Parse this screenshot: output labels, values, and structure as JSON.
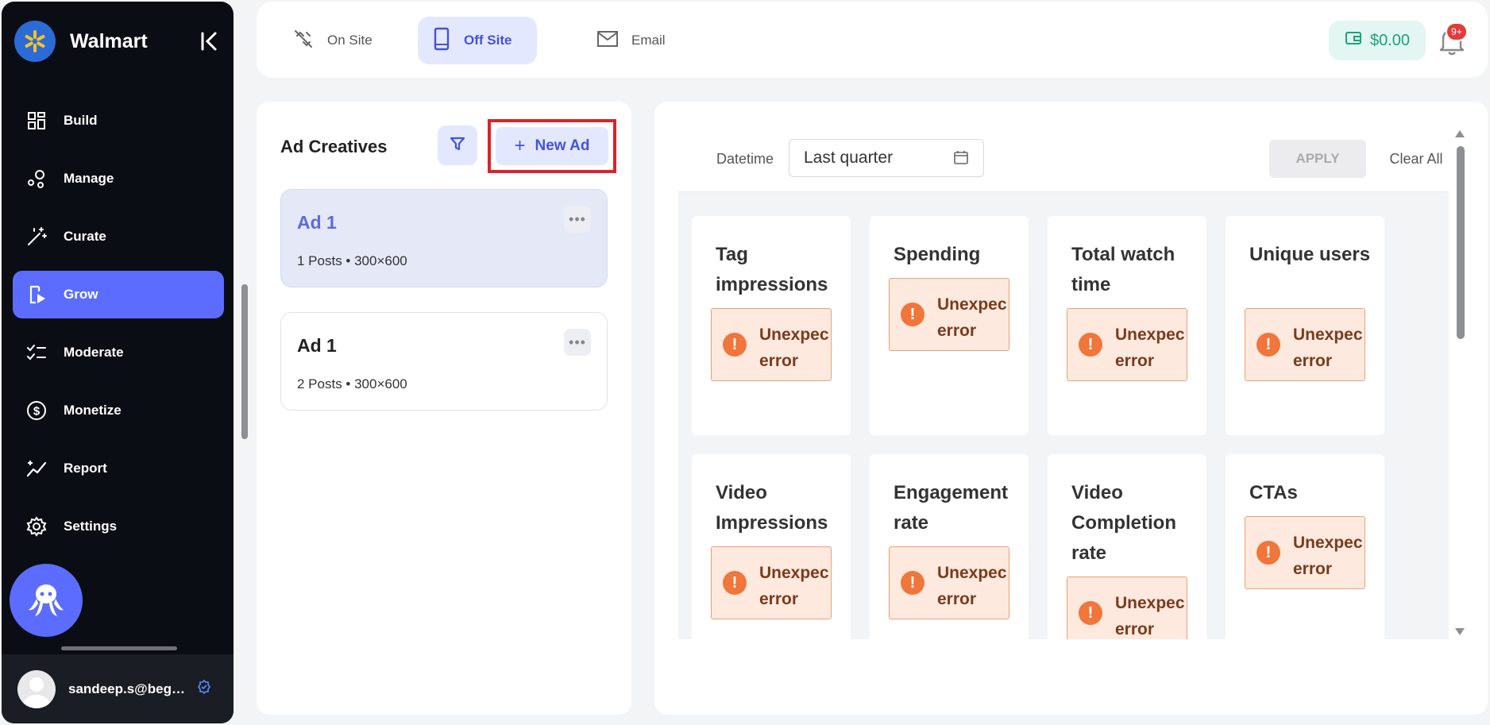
{
  "brand": {
    "name": "Walmart"
  },
  "sidebar": {
    "items": [
      {
        "label": "Build",
        "icon": "grid-icon"
      },
      {
        "label": "Manage",
        "icon": "manage-icon"
      },
      {
        "label": "Curate",
        "icon": "magic-wand-icon"
      },
      {
        "label": "Grow",
        "icon": "grow-icon",
        "active": true
      },
      {
        "label": "Moderate",
        "icon": "checklist-icon"
      },
      {
        "label": "Monetize",
        "icon": "dollar-icon"
      },
      {
        "label": "Report",
        "icon": "chart-icon"
      },
      {
        "label": "Settings",
        "icon": "gear-icon"
      }
    ],
    "user_email": "sandeep.s@begen..."
  },
  "topbar": {
    "tabs": [
      {
        "label": "On Site",
        "icon": "on-site-icon"
      },
      {
        "label": "Off Site",
        "icon": "mobile-icon",
        "active": true
      },
      {
        "label": "Email",
        "icon": "mail-icon"
      }
    ],
    "wallet": "$0.00",
    "notifications_badge": "9+"
  },
  "ads": {
    "title": "Ad Creatives",
    "new_ad": "New Ad",
    "items": [
      {
        "name": "Ad 1",
        "meta": "1 Posts • 300×600",
        "selected": true
      },
      {
        "name": "Ad 1",
        "meta": "2 Posts • 300×600",
        "selected": false
      }
    ]
  },
  "stats": {
    "datetime_label": "Datetime",
    "datetime_value": "Last quarter",
    "apply": "APPLY",
    "clear": "Clear All",
    "error_line1": "Unexpec",
    "error_line2": "error",
    "metrics": [
      "Tag impressions",
      "Spending",
      "Total watch time",
      "Unique users",
      "Video Impressions",
      "Engagement rate",
      "Video Completion rate",
      "CTAs"
    ]
  },
  "colors": {
    "accent": "#5b6cff",
    "sidebar_bg": "#0b0d14",
    "error_orange": "#f0763c",
    "highlight_red": "#d8232a"
  }
}
